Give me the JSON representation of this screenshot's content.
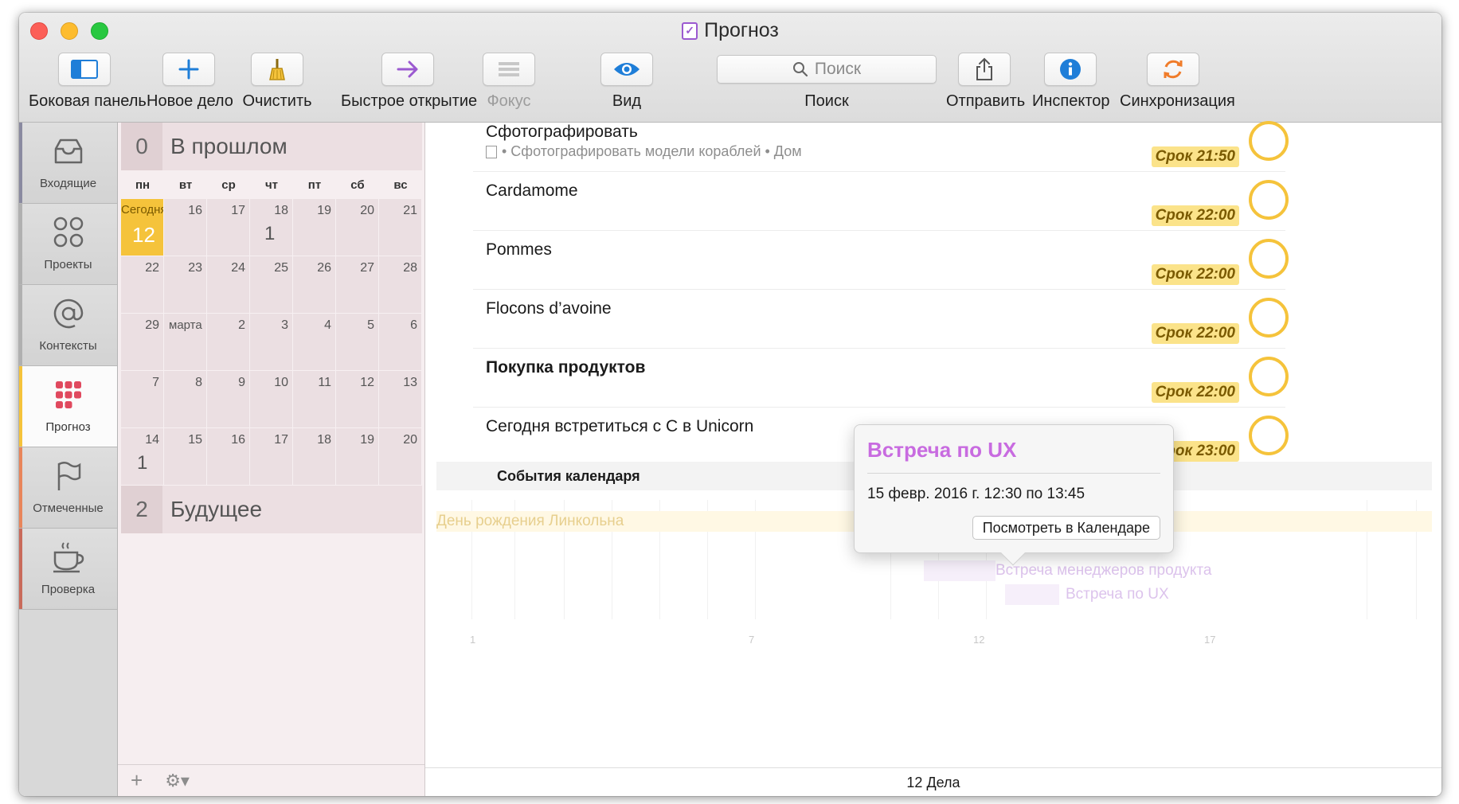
{
  "window": {
    "title": "Прогноз"
  },
  "toolbar": {
    "sidebar_label": "Боковая панель",
    "new_task_label": "Новое дело",
    "clean_label": "Очистить",
    "quick_open_label": "Быстрое открытие",
    "focus_label": "Фокус",
    "view_label": "Вид",
    "search_placeholder": "Поиск",
    "search_label": "Поиск",
    "share_label": "Отправить",
    "inspector_label": "Инспектор",
    "sync_label": "Синхронизация"
  },
  "perspectives": [
    {
      "label": "Входящие",
      "icon": "inbox-icon",
      "stripe": "#8a8aa0"
    },
    {
      "label": "Проекты",
      "icon": "projects-icon",
      "stripe": "#b0b0b0"
    },
    {
      "label": "Контексты",
      "icon": "at-icon",
      "stripe": "#b0b0b0"
    },
    {
      "label": "Прогноз",
      "icon": "forecast-icon",
      "stripe": "#f5c33b"
    },
    {
      "label": "Отмеченные",
      "icon": "flag-icon",
      "stripe": "#e8855a"
    },
    {
      "label": "Проверка",
      "icon": "coffee-icon",
      "stripe": "#c96a5a"
    }
  ],
  "calendar": {
    "past": {
      "count": "0",
      "label": "В прошлом"
    },
    "future": {
      "count": "2",
      "label": "Будущее"
    },
    "weekdays": [
      "пн",
      "вт",
      "ср",
      "чт",
      "пт",
      "сб",
      "вс"
    ],
    "today_label": "Сегодня",
    "today_num": "12",
    "rows": [
      [
        "",
        "16",
        "17",
        "18",
        "19",
        "20",
        "21"
      ],
      [
        "22",
        "23",
        "24",
        "25",
        "26",
        "27",
        "28"
      ],
      [
        "29",
        "марта",
        "2",
        "3",
        "4",
        "5",
        "6"
      ],
      [
        "7",
        "8",
        "9",
        "10",
        "11",
        "12",
        "13"
      ],
      [
        "14",
        "15",
        "16",
        "17",
        "18",
        "19",
        "20"
      ]
    ],
    "counts": {
      "r0c3": "1",
      "r4c0": "1"
    }
  },
  "tasks": [
    {
      "title": "Сфотографировать",
      "note": "• Сфотографировать модели кораблей • Дом",
      "due": "Срок 21:50",
      "bold": false
    },
    {
      "title": "Cardamome",
      "note": "",
      "due": "Срок 22:00",
      "bold": false
    },
    {
      "title": "Pommes",
      "note": "",
      "due": "Срок 22:00",
      "bold": false
    },
    {
      "title": "Flocons d’avoine",
      "note": "",
      "due": "Срок 22:00",
      "bold": false
    },
    {
      "title": "Покупка продуктов",
      "note": "",
      "due": "Срок 22:00",
      "bold": true
    },
    {
      "title": "Сегодня встретиться с C в Unicorn",
      "note": "",
      "due": "Срок 23:00",
      "bold": false
    }
  ],
  "events_section": "События календаря",
  "timeline": {
    "birthday": "День рождения Линкольна",
    "ev1": "Встреча менеджеров продукта",
    "ev2": "Встреча по UX",
    "ticks": [
      "1",
      "7",
      "12",
      "17"
    ]
  },
  "popover": {
    "title": "Встреча по UX",
    "time": "15 февр. 2016 г. 12:30 по 13:45",
    "button": "Посмотреть в Календаре"
  },
  "footer": {
    "count": "12 Дела"
  },
  "colors": {
    "accent_yellow": "#f5c33b",
    "event_purple": "#c86be0"
  }
}
